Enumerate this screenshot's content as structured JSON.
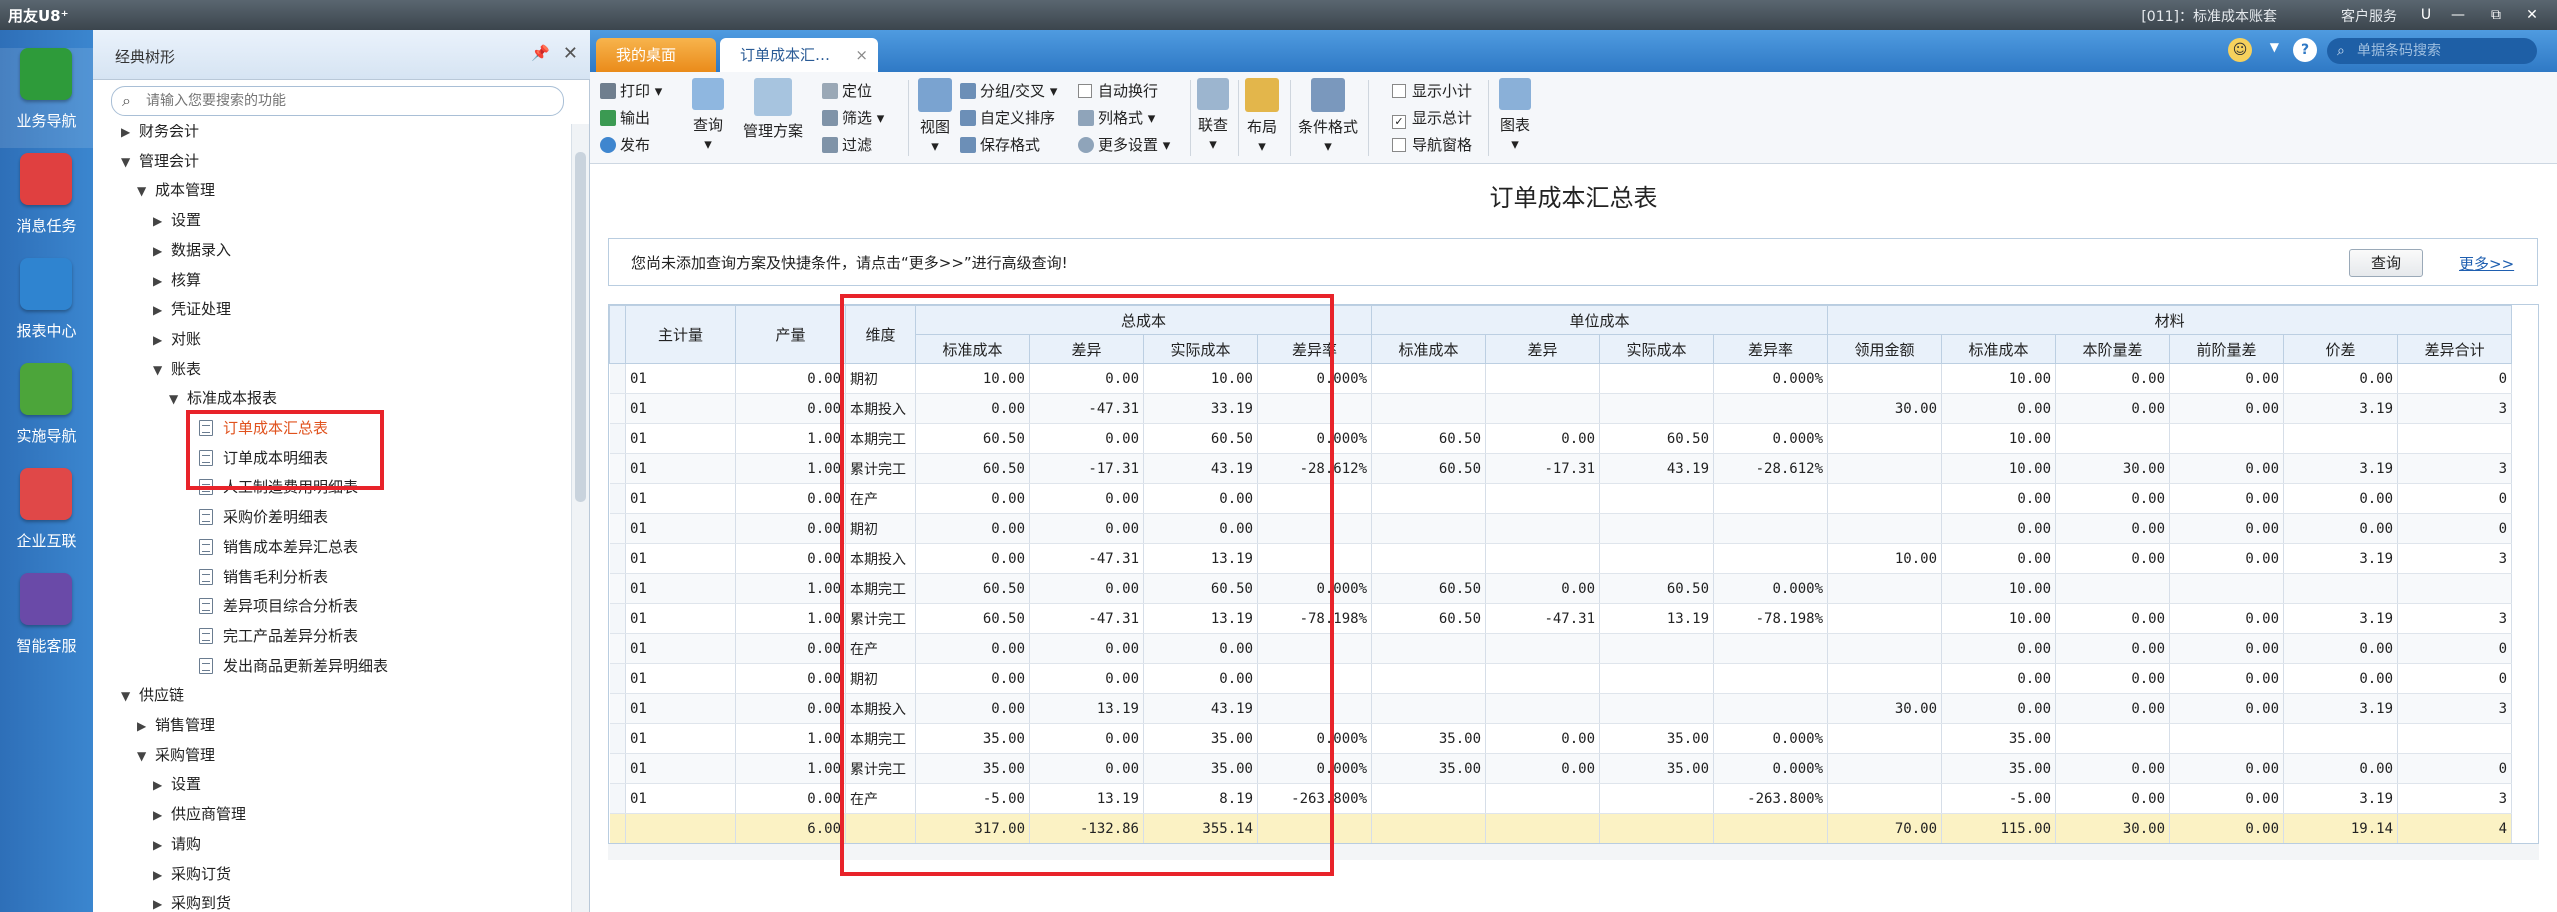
{
  "app": {
    "logo": "用友U8⁺",
    "account": "[011]：标准成本账套",
    "service": "客户服务",
    "window_buttons": [
      "U",
      "—",
      "⧉",
      "✕"
    ]
  },
  "rail": [
    {
      "label": "业务导航",
      "color": "#2e9b3a",
      "icon": "grid-icon"
    },
    {
      "label": "消息任务",
      "color": "#e04040",
      "icon": "mail-icon"
    },
    {
      "label": "报表中心",
      "color": "#2f84d0",
      "icon": "report-icon"
    },
    {
      "label": "实施导航",
      "color": "#4ca53a",
      "icon": "compass-icon"
    },
    {
      "label": "企业互联",
      "color": "#e04848",
      "icon": "network-icon"
    },
    {
      "label": "智能客服",
      "color": "#6a4aa8",
      "icon": "robot-icon"
    }
  ],
  "tree": {
    "title": "经典树形",
    "search_placeholder": "请输入您要搜索的功能",
    "nodes": [
      {
        "label": "财务会计",
        "level": 0,
        "arrow": "▶"
      },
      {
        "label": "管理会计",
        "level": 0,
        "arrow": "▼"
      },
      {
        "label": "成本管理",
        "level": 1,
        "arrow": "▼"
      },
      {
        "label": "设置",
        "level": 2,
        "arrow": "▶"
      },
      {
        "label": "数据录入",
        "level": 2,
        "arrow": "▶"
      },
      {
        "label": "核算",
        "level": 2,
        "arrow": "▶"
      },
      {
        "label": "凭证处理",
        "level": 2,
        "arrow": "▶"
      },
      {
        "label": "对账",
        "level": 2,
        "arrow": "▶"
      },
      {
        "label": "账表",
        "level": 2,
        "arrow": "▼"
      },
      {
        "label": "标准成本报表",
        "level": 3,
        "arrow": "▼"
      },
      {
        "label": "订单成本汇总表",
        "level": 4,
        "doc": true,
        "hl": true
      },
      {
        "label": "订单成本明细表",
        "level": 4,
        "doc": true
      },
      {
        "label": "人工制造费用明细表",
        "level": 4,
        "doc": true
      },
      {
        "label": "采购价差明细表",
        "level": 4,
        "doc": true
      },
      {
        "label": "销售成本差异汇总表",
        "level": 4,
        "doc": true
      },
      {
        "label": "销售毛利分析表",
        "level": 4,
        "doc": true
      },
      {
        "label": "差异项目综合分析表",
        "level": 4,
        "doc": true
      },
      {
        "label": "完工产品差异分析表",
        "level": 4,
        "doc": true
      },
      {
        "label": "发出商品更新差异明细表",
        "level": 4,
        "doc": true
      },
      {
        "label": "供应链",
        "level": 0,
        "arrow": "▼"
      },
      {
        "label": "销售管理",
        "level": 1,
        "arrow": "▶"
      },
      {
        "label": "采购管理",
        "level": 1,
        "arrow": "▼"
      },
      {
        "label": "设置",
        "level": 2,
        "arrow": "▶"
      },
      {
        "label": "供应商管理",
        "level": 2,
        "arrow": "▶"
      },
      {
        "label": "请购",
        "level": 2,
        "arrow": "▶"
      },
      {
        "label": "采购订货",
        "level": 2,
        "arrow": "▶"
      },
      {
        "label": "采购到货",
        "level": 2,
        "arrow": "▶"
      }
    ]
  },
  "tabs": [
    {
      "label": "我的桌面"
    },
    {
      "label": "订单成本汇…",
      "close": "×"
    }
  ],
  "tabbar": {
    "search_placeholder": "单据条码搜索"
  },
  "toolbar": {
    "small": [
      {
        "label": "打印",
        "caret": true
      },
      {
        "label": "输出"
      },
      {
        "label": "发布"
      }
    ],
    "query": "查询",
    "plan": "管理方案",
    "filters": [
      {
        "label": "定位"
      },
      {
        "label": "筛选",
        "caret": true
      },
      {
        "label": "过滤"
      }
    ],
    "view": "视图",
    "view_items": [
      {
        "label": "分组/交叉",
        "caret": true
      },
      {
        "label": "自定义排序"
      },
      {
        "label": "保存格式"
      }
    ],
    "view_items2": [
      {
        "label": "自动换行",
        "check": false
      },
      {
        "label": "列格式",
        "caret": true
      },
      {
        "label": "更多设置",
        "caret": true
      }
    ],
    "link": "联查",
    "layout": "布局",
    "cond_format": "条件格式",
    "checks": [
      {
        "label": "显示小计",
        "checked": false
      },
      {
        "label": "显示总计",
        "checked": true
      },
      {
        "label": "导航窗格",
        "checked": false
      }
    ],
    "chart": "图表",
    "tooltip": "视图"
  },
  "report": {
    "title": "订单成本汇总表",
    "query_msg": "您尚未添加查询方案及快捷条件，请点击“更多>>”进行高级查询!",
    "query_btn": "查询",
    "more_link": "更多>>",
    "group_headers": [
      "总成本",
      "单位成本",
      "材料"
    ],
    "columns": [
      "主计量",
      "产量",
      "维度",
      "标准成本",
      "差异",
      "实际成本",
      "差异率",
      "标准成本",
      "差异",
      "实际成本",
      "差异率",
      "领用金额",
      "标准成本",
      "本阶量差",
      "前阶量差",
      "价差",
      "差异合计"
    ],
    "rows": [
      [
        "01",
        "0.00",
        "期初",
        "10.00",
        "0.00",
        "10.00",
        "0.000%",
        "",
        "",
        "",
        "0.000%",
        "",
        "10.00",
        "0.00",
        "0.00",
        "0.00",
        "0"
      ],
      [
        "01",
        "0.00",
        "本期投入",
        "0.00",
        "-47.31",
        "33.19",
        "",
        "",
        "",
        "",
        "",
        "30.00",
        "0.00",
        "0.00",
        "0.00",
        "3.19",
        "3"
      ],
      [
        "01",
        "1.00",
        "本期完工",
        "60.50",
        "0.00",
        "60.50",
        "0.000%",
        "60.50",
        "0.00",
        "60.50",
        "0.000%",
        "",
        "10.00",
        "",
        "",
        "",
        ""
      ],
      [
        "01",
        "1.00",
        "累计完工",
        "60.50",
        "-17.31",
        "43.19",
        "-28.612%",
        "60.50",
        "-17.31",
        "43.19",
        "-28.612%",
        "",
        "10.00",
        "30.00",
        "0.00",
        "3.19",
        "3"
      ],
      [
        "01",
        "0.00",
        "在产",
        "0.00",
        "0.00",
        "0.00",
        "",
        "",
        "",
        "",
        "",
        "",
        "0.00",
        "0.00",
        "0.00",
        "0.00",
        "0"
      ],
      [
        "01",
        "0.00",
        "期初",
        "0.00",
        "0.00",
        "0.00",
        "",
        "",
        "",
        "",
        "",
        "",
        "0.00",
        "0.00",
        "0.00",
        "0.00",
        "0"
      ],
      [
        "01",
        "0.00",
        "本期投入",
        "0.00",
        "-47.31",
        "13.19",
        "",
        "",
        "",
        "",
        "",
        "10.00",
        "0.00",
        "0.00",
        "0.00",
        "3.19",
        "3"
      ],
      [
        "01",
        "1.00",
        "本期完工",
        "60.50",
        "0.00",
        "60.50",
        "0.000%",
        "60.50",
        "0.00",
        "60.50",
        "0.000%",
        "",
        "10.00",
        "",
        "",
        "",
        ""
      ],
      [
        "01",
        "1.00",
        "累计完工",
        "60.50",
        "-47.31",
        "13.19",
        "-78.198%",
        "60.50",
        "-47.31",
        "13.19",
        "-78.198%",
        "",
        "10.00",
        "0.00",
        "0.00",
        "3.19",
        "3"
      ],
      [
        "01",
        "0.00",
        "在产",
        "0.00",
        "0.00",
        "0.00",
        "",
        "",
        "",
        "",
        "",
        "",
        "0.00",
        "0.00",
        "0.00",
        "0.00",
        "0"
      ],
      [
        "01",
        "0.00",
        "期初",
        "0.00",
        "0.00",
        "0.00",
        "",
        "",
        "",
        "",
        "",
        "",
        "0.00",
        "0.00",
        "0.00",
        "0.00",
        "0"
      ],
      [
        "01",
        "0.00",
        "本期投入",
        "0.00",
        "13.19",
        "43.19",
        "",
        "",
        "",
        "",
        "",
        "30.00",
        "0.00",
        "0.00",
        "0.00",
        "3.19",
        "3"
      ],
      [
        "01",
        "1.00",
        "本期完工",
        "35.00",
        "0.00",
        "35.00",
        "0.000%",
        "35.00",
        "0.00",
        "35.00",
        "0.000%",
        "",
        "35.00",
        "",
        "",
        "",
        ""
      ],
      [
        "01",
        "1.00",
        "累计完工",
        "35.00",
        "0.00",
        "35.00",
        "0.000%",
        "35.00",
        "0.00",
        "35.00",
        "0.000%",
        "",
        "35.00",
        "0.00",
        "0.00",
        "0.00",
        "0"
      ],
      [
        "01",
        "0.00",
        "在产",
        "-5.00",
        "13.19",
        "8.19",
        "-263.800%",
        "",
        "",
        "",
        "-263.800%",
        "",
        "-5.00",
        "0.00",
        "0.00",
        "3.19",
        "3"
      ]
    ],
    "total": [
      "",
      "6.00",
      "",
      "317.00",
      "-132.86",
      "355.14",
      "",
      "",
      "",
      "",
      "",
      "70.00",
      "115.00",
      "30.00",
      "0.00",
      "19.14",
      "4"
    ]
  }
}
